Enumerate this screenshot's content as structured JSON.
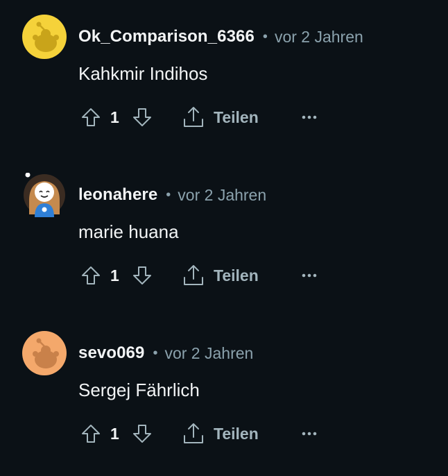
{
  "colors": {
    "background": "#0b1116",
    "text": "#f2f4f5",
    "muted": "#8ba2ad",
    "icon": "#a3b5bd"
  },
  "comments": [
    {
      "username": "Ok_Comparison_6366",
      "separator": "•",
      "time": "vor 2 Jahren",
      "text": "Kahkmir Indihos",
      "votes": "1",
      "share_label": "Teilen",
      "more_label": "···",
      "avatar": {
        "type": "snoo",
        "color": "#f5d23a",
        "fg": "#c9a41a"
      }
    },
    {
      "username": "leonahere",
      "separator": "•",
      "time": "vor 2 Jahren",
      "text": "marie huana",
      "votes": "1",
      "share_label": "Teilen",
      "more_label": "···",
      "avatar": {
        "type": "custom-snoo",
        "color": "#3b2c22",
        "fg": "#2f7fd6"
      }
    },
    {
      "username": "sevo069",
      "separator": "•",
      "time": "vor 2 Jahren",
      "text": "Sergej Fährlich",
      "votes": "1",
      "share_label": "Teilen",
      "more_label": "···",
      "avatar": {
        "type": "snoo",
        "color": "#f4a86b",
        "fg": "#c9814a"
      }
    }
  ]
}
